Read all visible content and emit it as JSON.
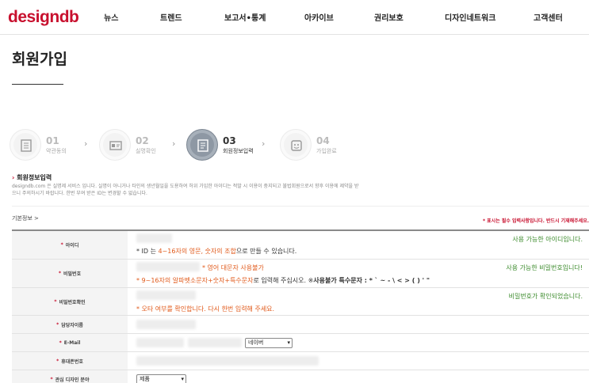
{
  "header": {
    "logo_part1": "design",
    "logo_part2": "db",
    "nav": [
      "뉴스",
      "트렌드",
      "보고서•통계",
      "아카이브",
      "권리보호",
      "디자인네트워크",
      "고객센터"
    ]
  },
  "page": {
    "title": "회원가입"
  },
  "steps": [
    {
      "num": "01",
      "name": "약관동의",
      "icon": "document-icon"
    },
    {
      "num": "02",
      "name": "실명확인",
      "icon": "id-card-icon"
    },
    {
      "num": "03",
      "name": "회원정보입력",
      "icon": "form-icon",
      "active": true
    },
    {
      "num": "04",
      "name": "가입완료",
      "icon": "smile-icon"
    }
  ],
  "section": {
    "title": "회원정보입력",
    "desc": "designdb.com 은 실명제 서비스 입니다. 실명이 아니거나 타인의 생년월일을 도용하여 허위 가입한 아이디는 적발 시 이용이 중지되고 불법회원으로서 향후 이용에 제약을 받으니 주의하시기 바랍니다. 한번 부여 받은 ID는 변경할 수 없습니다.",
    "basic_label": "기본정보 >",
    "required_note": "* 표시는 필수 입력사항입니다. 반드시 기재해주세요."
  },
  "form": {
    "id": {
      "label": "아이디",
      "note_a": "* ID 는 ",
      "note_hl": "4~16자의 영문, 숫자의 조합",
      "note_b": "으로 만들 수 있습니다.",
      "ok": "사용 가능한 아이디입니다."
    },
    "password": {
      "label": "비밀번호",
      "warn": "* 영어 대문자 사용불가",
      "note_hl": "* 9~16자의 알파벳소문자+숫자+특수문자",
      "note_b": "로 입력해 주십시오. ※",
      "note_bold": "사용불가 특수문자 : * ` ~ - \\ < > ( ) ' \"",
      "ok": "사용 가능한 비밀번호입니다!"
    },
    "password_confirm": {
      "label": "비밀번호확인",
      "warn": "* 오타 여부를 확인합니다. 다시 한번 입력해 주세요.",
      "ok": "비밀번호가 확인되었습니다."
    },
    "manager_name": {
      "label": "담당자이름"
    },
    "email": {
      "label": "E-Mail",
      "domain_select": "네이버"
    },
    "mobile": {
      "label": "휴대폰번호"
    },
    "design_field": {
      "label": "관심 디자인 분야",
      "select": "제품"
    }
  },
  "colors": {
    "brand": "#c8102e",
    "ok": "#3a8a2a",
    "highlight": "#e15a1b"
  }
}
